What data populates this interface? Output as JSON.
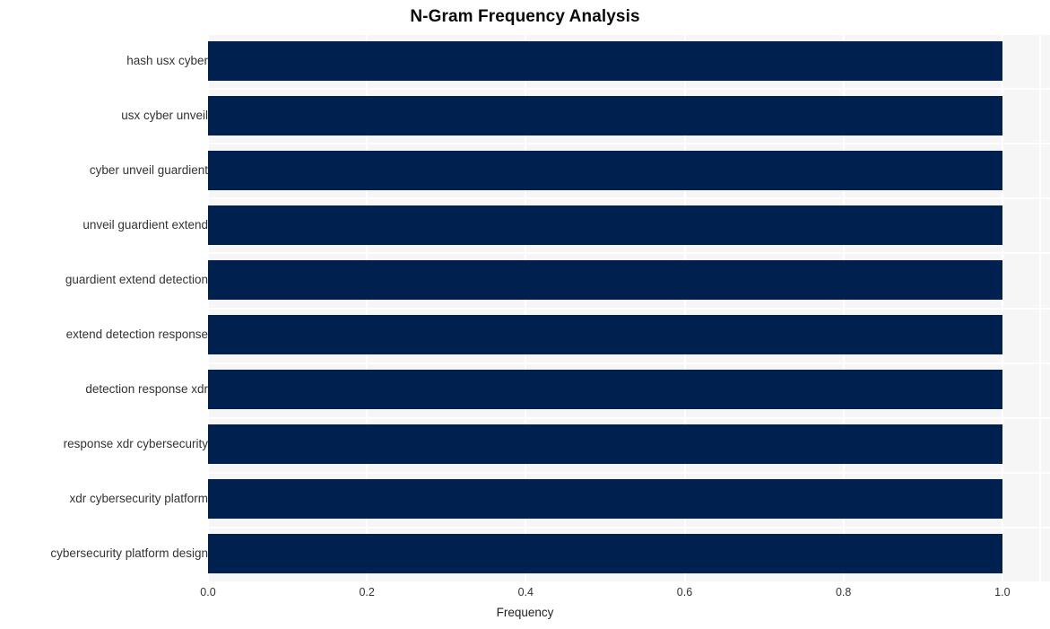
{
  "chart_data": {
    "type": "bar",
    "orientation": "horizontal",
    "title": "N-Gram Frequency Analysis",
    "xlabel": "Frequency",
    "ylabel": "",
    "categories": [
      "hash usx cyber",
      "usx cyber unveil",
      "cyber unveil guardient",
      "unveil guardient extend",
      "guardient extend detection",
      "extend detection response",
      "detection response xdr",
      "response xdr cybersecurity",
      "xdr cybersecurity platform",
      "cybersecurity platform design"
    ],
    "values": [
      1.0,
      1.0,
      1.0,
      1.0,
      1.0,
      1.0,
      1.0,
      1.0,
      1.0,
      1.0
    ],
    "xlim": [
      0.0,
      1.06
    ],
    "xticks": [
      0.0,
      0.2,
      0.4,
      0.6,
      0.8,
      1.0
    ],
    "xtick_labels": [
      "0.0",
      "0.2",
      "0.4",
      "0.6",
      "0.8",
      "1.0"
    ],
    "grid": true,
    "grid_color": "#ffffff",
    "legend": null,
    "bar_color": "#002050",
    "plot_background": "#f6f6f7",
    "figure_background": "#ffffff",
    "tick_label_color": "#333333",
    "title_color": "#0b0b0b"
  }
}
